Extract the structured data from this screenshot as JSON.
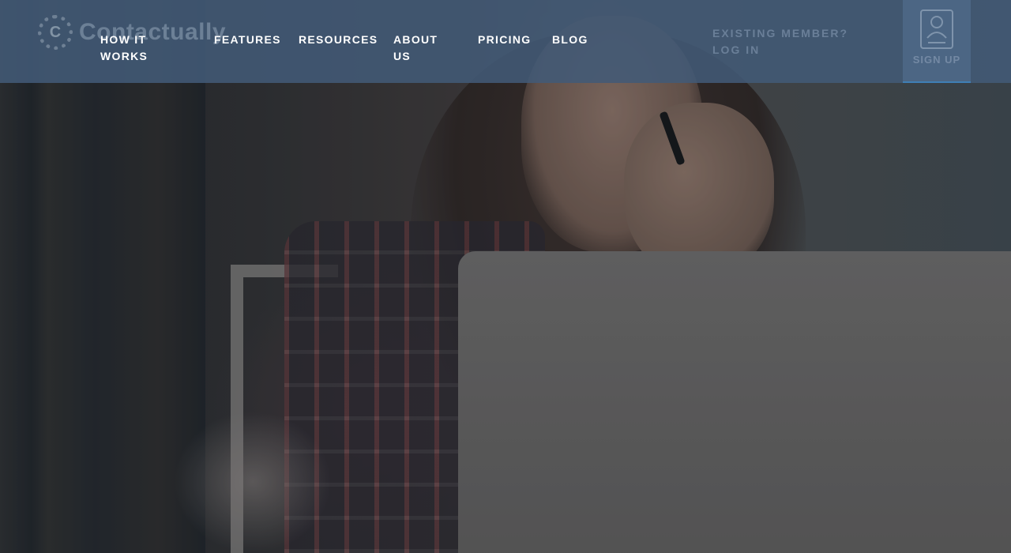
{
  "brand": {
    "logo_text": "Contactually",
    "logo_mark": "C"
  },
  "nav": {
    "items": [
      {
        "label": "HOW IT WORKS"
      },
      {
        "label": "FEATURES"
      },
      {
        "label": "RESOURCES"
      },
      {
        "label": "ABOUT US"
      },
      {
        "label": "PRICING"
      },
      {
        "label": "BLOG"
      }
    ]
  },
  "account": {
    "login_label": "EXISTING MEMBER? LOG IN",
    "signup_label": "SIGN UP",
    "signup_icon": "user-id-card-icon"
  },
  "colors": {
    "header_bg": "#425a76",
    "nav_text": "#ffffff",
    "accent": "#3f7fb5"
  }
}
